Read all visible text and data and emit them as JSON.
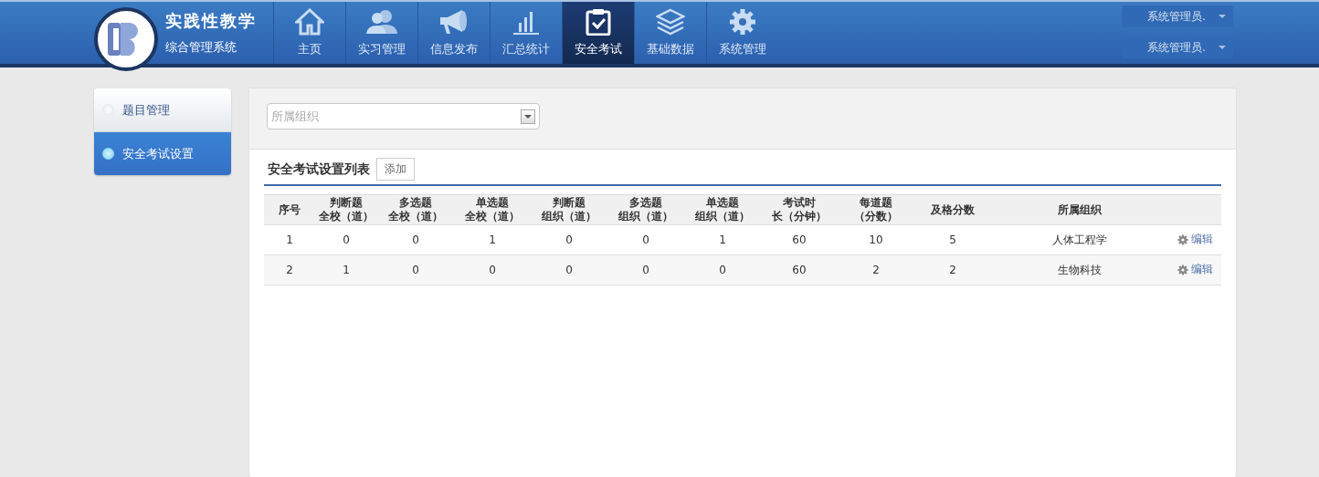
{
  "header": {
    "title": "实践性教学",
    "subtitle": "综合管理系统"
  },
  "nav": [
    {
      "label": "主页",
      "selected": false
    },
    {
      "label": "实习管理",
      "selected": false
    },
    {
      "label": "信息发布",
      "selected": false
    },
    {
      "label": "汇总统计",
      "selected": false
    },
    {
      "label": "安全考试",
      "selected": true
    },
    {
      "label": "基础数据",
      "selected": false
    },
    {
      "label": "系统管理",
      "selected": false
    }
  ],
  "user_menus": [
    "系统管理员.",
    "系统管理员."
  ],
  "sidebar": {
    "items": [
      {
        "label": "题目管理",
        "selected": false
      },
      {
        "label": "安全考试设置",
        "selected": true
      }
    ]
  },
  "filter": {
    "placeholder": "所属组织"
  },
  "list": {
    "title": "安全考试设置列表",
    "add_button": "添加"
  },
  "table": {
    "columns": [
      {
        "label": "序号"
      },
      {
        "label": "判断题",
        "sublabel": "全校（道）"
      },
      {
        "label": "多选题",
        "sublabel": "全校（道）"
      },
      {
        "label": "单选题",
        "sublabel": "全校（道）"
      },
      {
        "label": "判断题",
        "sublabel": "组织（道）"
      },
      {
        "label": "多选题",
        "sublabel": "组织（道）"
      },
      {
        "label": "单选题",
        "sublabel": "组织（道）"
      },
      {
        "label": "考试时",
        "sublabel": "长（分钟）"
      },
      {
        "label": "每道题",
        "sublabel": "（分数）"
      },
      {
        "label": "及格分数"
      },
      {
        "label": "所属组织"
      }
    ],
    "rows": [
      {
        "cells": [
          "1",
          "0",
          "0",
          "1",
          "0",
          "0",
          "1",
          "60",
          "10",
          "5",
          "人体工程学"
        ],
        "action": "编辑"
      },
      {
        "cells": [
          "2",
          "1",
          "0",
          "0",
          "0",
          "0",
          "0",
          "60",
          "2",
          "2",
          "生物科技"
        ],
        "action": "编辑"
      }
    ]
  }
}
